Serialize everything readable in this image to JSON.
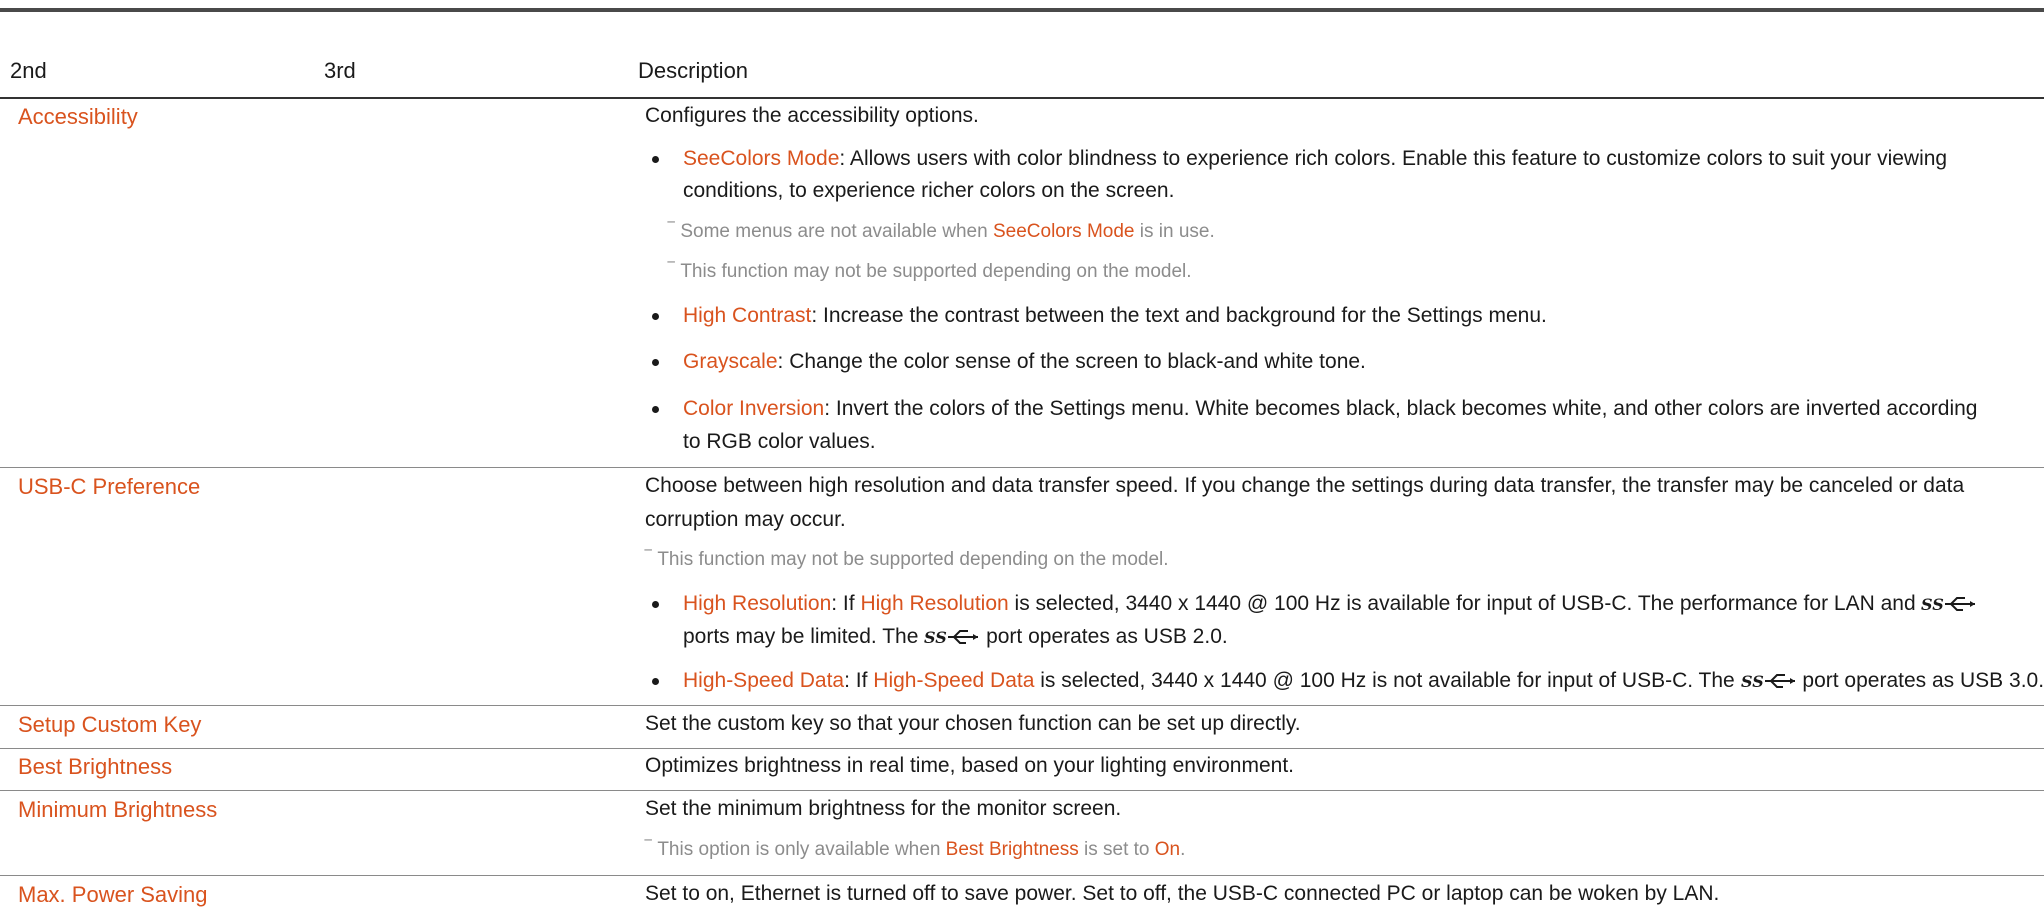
{
  "headers": {
    "col2": "2nd",
    "col3": "3rd",
    "desc": "Description"
  },
  "rows": {
    "accessibility": {
      "label": "Accessibility",
      "desc": "Configures the accessibility options.",
      "seecolors_term": "SeeColors Mode",
      "seecolors_line1": ": Allows users with color blindness to experience rich colors. Enable this feature to customize colors to suit your viewing",
      "seecolors_line2": "conditions, to experience richer colors on the screen.",
      "note1_pre": "Some menus are not available when ",
      "note1_term": "SeeColors Mode",
      "note1_post": " is in use.",
      "note2": "This function may not be supported depending on the model.",
      "highcontrast_term": "High Contrast",
      "highcontrast_text": ": Increase the contrast between the text and background for the Settings menu.",
      "grayscale_term": "Grayscale",
      "grayscale_text": ": Change the color sense of the screen to black-and white tone.",
      "inversion_term": "Color Inversion",
      "inversion_line1": ": Invert the colors of the Settings menu. White becomes black, black becomes white, and other colors are inverted according",
      "inversion_line2": "to RGB color values."
    },
    "usbc": {
      "label": "USB-C Preference",
      "desc_line1": "Choose between high resolution and data transfer speed. If you change the settings during data transfer, the transfer may be canceled or data",
      "desc_line2": "corruption may occur.",
      "note": "This function may not be supported depending on the model.",
      "highres_term": "High Resolution",
      "highres_a": ": If ",
      "highres_term2": "High Resolution",
      "highres_b": " is selected, 3440 x 1440 @ 100 Hz is available for input of USB-C. The performance for LAN and",
      "highres_line2_a": "ports may be limited. The",
      "highres_line2_b": "port operates as USB 2.0.",
      "highspeed_term": "High-Speed Data",
      "highspeed_a": ": If ",
      "highspeed_term2": "High-Speed Data",
      "highspeed_b": " is selected, 3440 x 1440 @ 100 Hz is not available for input of USB-C. The",
      "highspeed_c": "port operates as USB 3.0."
    },
    "customkey": {
      "label": "Setup Custom Key",
      "desc": "Set the custom key so that your chosen function can be set up directly."
    },
    "bestbrightness": {
      "label": "Best Brightness",
      "desc": "Optimizes brightness in real time, based on your lighting environment."
    },
    "minbrightness": {
      "label": "Minimum Brightness",
      "desc": "Set the minimum brightness for the monitor screen.",
      "note_pre": "This option is only available when ",
      "note_term": "Best Brightness",
      "note_mid": " is set to ",
      "note_term2": "On",
      "note_post": "."
    },
    "maxpower": {
      "label": "Max. Power Saving",
      "desc": "Set to on, Ethernet is turned off to save power. Set to off, the USB-C connected PC or laptop can be woken by LAN."
    }
  },
  "icons": {
    "usb_ss": "usb-superspeed-icon"
  },
  "colors": {
    "accent": "#d9531e",
    "note": "#8c8c8c",
    "text": "#1a1a1a"
  }
}
